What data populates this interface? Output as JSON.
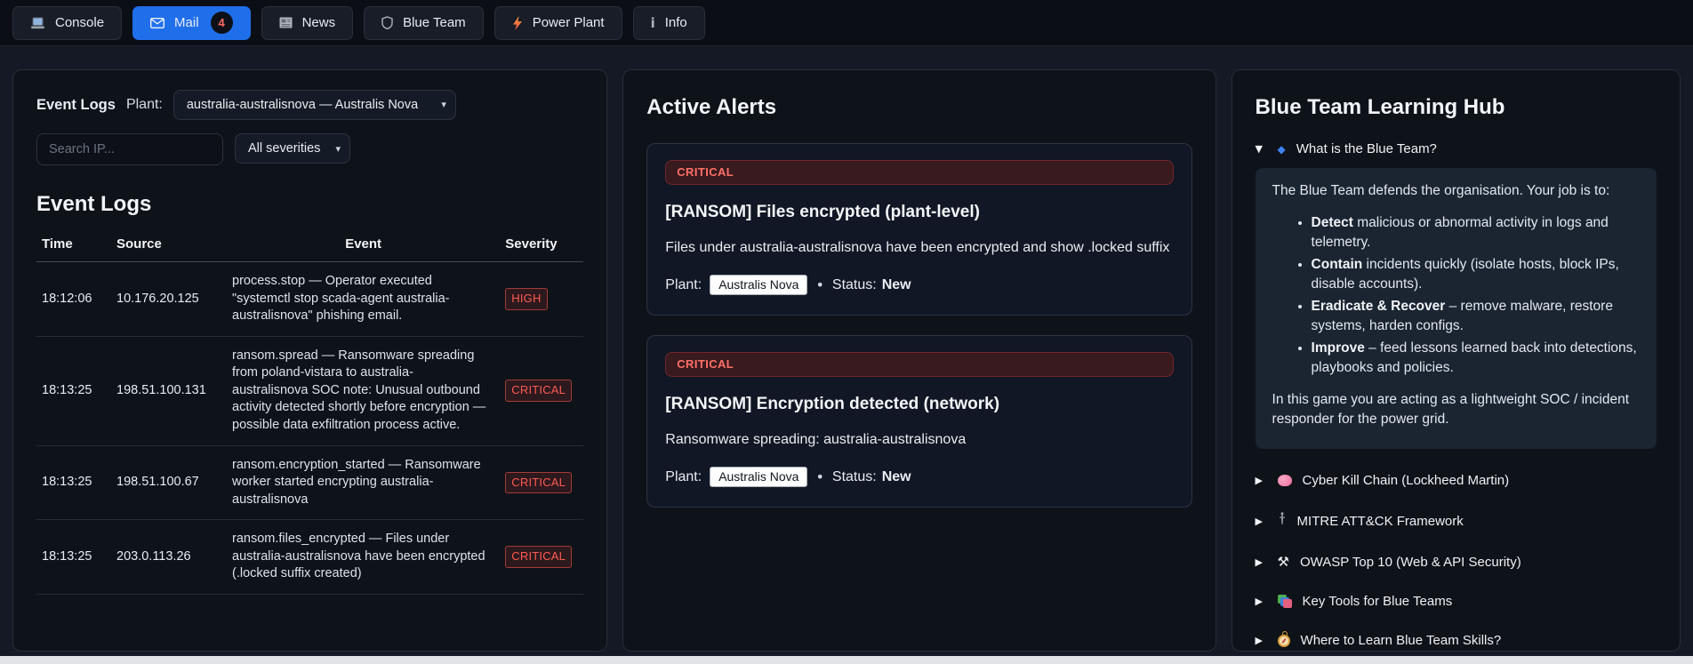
{
  "nav": {
    "tabs": [
      {
        "label": "Console",
        "icon": "laptop-icon"
      },
      {
        "label": "Mail",
        "icon": "mail-icon",
        "badge": "4",
        "active": true
      },
      {
        "label": "News",
        "icon": "news-icon"
      },
      {
        "label": "Blue Team",
        "icon": "shield-icon"
      },
      {
        "label": "Power Plant",
        "icon": "lightning-icon"
      },
      {
        "label": "Info",
        "icon": "info-icon"
      }
    ]
  },
  "glyphs": {
    "expanded": "▼",
    "collapsed": "▶",
    "diamond": "◆",
    "chevron": "▾",
    "separator": "•",
    "info": "i",
    "tools": "⚒"
  },
  "event_logs_panel": {
    "title": "Event Logs",
    "plant_label": "Plant:",
    "plant_selected": "australia-australisnova — Australis Nova",
    "search_placeholder": "Search IP...",
    "severity_filter": "All severities",
    "section_title": "Event Logs",
    "table": {
      "headers": [
        "Time",
        "Source",
        "Event",
        "Severity"
      ],
      "rows": [
        {
          "time": "18:12:06",
          "source": "10.176.20.125",
          "event": "process.stop — Operator executed \"systemctl stop scada-agent australia-australisnova\" phishing email.",
          "severity": "HIGH"
        },
        {
          "time": "18:13:25",
          "source": "198.51.100.131",
          "event": "ransom.spread — Ransomware spreading from poland-vistara to australia-australisnova SOC note: Unusual outbound activity detected shortly before encryption — possible data exfiltration process active.",
          "severity": "CRITICAL"
        },
        {
          "time": "18:13:25",
          "source": "198.51.100.67",
          "event": "ransom.encryption_started — Ransomware worker started encrypting australia-australisnova",
          "severity": "CRITICAL"
        },
        {
          "time": "18:13:25",
          "source": "203.0.113.26",
          "event": "ransom.files_encrypted — Files under australia-australisnova have been encrypted (.locked suffix created)",
          "severity": "CRITICAL"
        }
      ]
    }
  },
  "alerts_panel": {
    "title": "Active Alerts",
    "alerts": [
      {
        "severity": "CRITICAL",
        "title": "[RANSOM] Files encrypted (plant-level)",
        "description": "Files under australia-australisnova have been encrypted and show .locked suffix",
        "plant_label": "Plant:",
        "plant": "Australis Nova",
        "status_label": "Status:",
        "status": "New"
      },
      {
        "severity": "CRITICAL",
        "title": "[RANSOM] Encryption detected (network)",
        "description": "Ransomware spreading: australia-australisnova",
        "plant_label": "Plant:",
        "plant": "Australis Nova",
        "status_label": "Status:",
        "status": "New"
      }
    ]
  },
  "learning_panel": {
    "title": "Blue Team Learning Hub",
    "expanded_section": {
      "icon": "blue-diamond-icon",
      "label": "What is the Blue Team?",
      "intro": "The Blue Team defends the organisation. Your job is to:",
      "bullets": [
        {
          "lead": "Detect",
          "rest": " malicious or abnormal activity in logs and telemetry."
        },
        {
          "lead": "Contain",
          "rest": " incidents quickly (isolate hosts, block IPs, disable accounts)."
        },
        {
          "lead": "Eradicate & Recover",
          "rest": " – remove malware, restore systems, harden configs."
        },
        {
          "lead": "Improve",
          "rest": " – feed lessons learned back into detections, playbooks and policies."
        }
      ],
      "outro": "In this game you are acting as a lightweight SOC / incident responder for the power grid."
    },
    "collapsed_sections": [
      {
        "icon": "brain-icon",
        "label": "Cyber Kill Chain (Lockheed Martin)"
      },
      {
        "icon": "dagger-icon",
        "label": "MITRE ATT&CK Framework"
      },
      {
        "icon": "tools-icon",
        "label": "OWASP Top 10 (Web & API Security)"
      },
      {
        "icon": "layers-icon",
        "label": "Key Tools for Blue Teams"
      },
      {
        "icon": "compass-icon",
        "label": "Where to Learn Blue Team Skills?"
      }
    ]
  },
  "colors": {
    "accent_blue": "#1f6feb",
    "critical_red": "#f85149",
    "page_bg": "#141925",
    "panel_bg": "#0e1219",
    "hub_content_bg": "#1b2431"
  }
}
